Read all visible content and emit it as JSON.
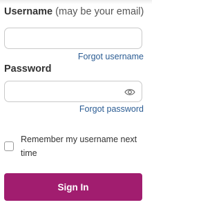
{
  "username": {
    "label": "Username",
    "hint": "(may be your email)",
    "value": "",
    "forgot_link": "Forgot username"
  },
  "password": {
    "label": "Password",
    "value": "",
    "toggle_icon": "eye-icon",
    "forgot_link": "Forgot password"
  },
  "remember": {
    "label": "Remember my username next time",
    "checked": false
  },
  "sign_in": {
    "label": "Sign In",
    "color": "#a11d6f"
  },
  "colors": {
    "link": "#2b5c93",
    "text": "#333333",
    "border": "#c9c9c9"
  }
}
